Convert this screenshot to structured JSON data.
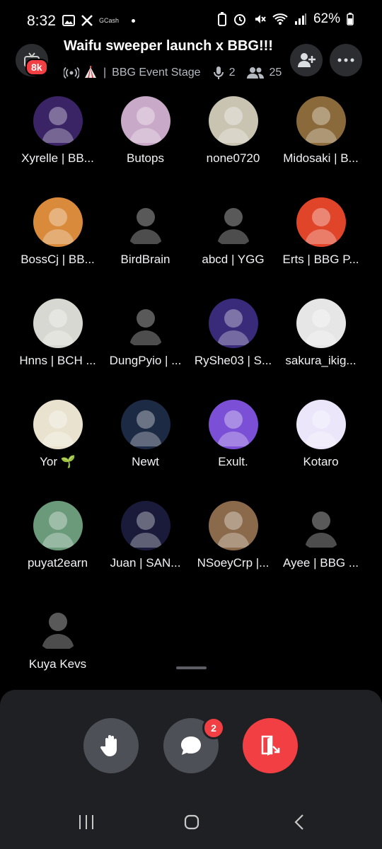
{
  "status_bar": {
    "time": "8:32",
    "gcash": "GCash",
    "battery": "62%"
  },
  "header": {
    "title": "Waifu sweeper launch x BBG!!!",
    "badge": "8k",
    "stage_name": "BBG Event Stage",
    "speakers_count": "2",
    "listeners_count": "25",
    "separator": "|"
  },
  "participants": [
    {
      "name": "Xyrelle | BB...",
      "color": "#3a2466"
    },
    {
      "name": "Butops",
      "color": "#c9a9c8"
    },
    {
      "name": "none0720",
      "color": "#c9c4b2"
    },
    {
      "name": "Midosaki | B...",
      "color": "#8a6a3a"
    },
    {
      "name": "BossCj | BB...",
      "color": "#d98a3a"
    },
    {
      "name": "BirdBrain",
      "color": "#000000"
    },
    {
      "name": "abcd | YGG",
      "color": "#000000"
    },
    {
      "name": "Erts | BBG P...",
      "color": "#e0452a"
    },
    {
      "name": "Hnns | BCH ...",
      "color": "#d8d8d2"
    },
    {
      "name": "DungPyio | ...",
      "color": "#000000"
    },
    {
      "name": "RyShe03 | S...",
      "color": "#3a2a7a"
    },
    {
      "name": "sakura_ikig...",
      "color": "#e6e6e6"
    },
    {
      "name": "Yor 🌱",
      "color": "#e9e2cf"
    },
    {
      "name": "Newt",
      "color": "#1d2a44"
    },
    {
      "name": "Exult.",
      "color": "#7b4fd6"
    },
    {
      "name": "Kotaro",
      "color": "#ece6fa"
    },
    {
      "name": "puyat2earn",
      "color": "#6a9a7a"
    },
    {
      "name": "Juan | SAN...",
      "color": "#1a1a3a"
    },
    {
      "name": "NSoeyCrp  |...",
      "color": "#8a6a4a"
    },
    {
      "name": "Ayee | BBG ...",
      "color": "#000000"
    },
    {
      "name": "Kuya Kevs",
      "color": "#000000"
    }
  ],
  "controls": {
    "chat_badge": "2",
    "hand_color": "#4e5058",
    "chat_color": "#4e5058",
    "leave_color": "#f23f43"
  }
}
